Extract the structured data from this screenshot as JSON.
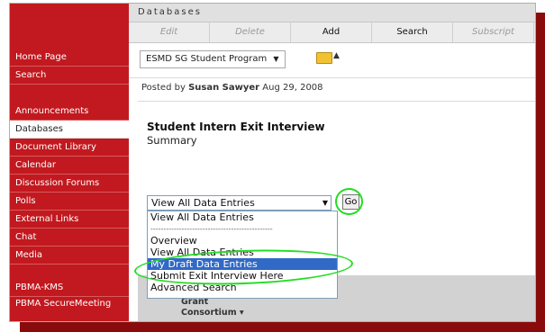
{
  "header": {
    "title": "Databases"
  },
  "toolbar": {
    "items": [
      "Edit",
      "Delete",
      "Add",
      "Search",
      "Subscript"
    ]
  },
  "program_select": {
    "value": "ESMD SG Student Program"
  },
  "sidebar": {
    "group1": [
      "Home Page",
      "Search"
    ],
    "group2": [
      "Announcements",
      "Databases",
      "Document Library",
      "Calendar",
      "Discussion Forums",
      "Polls",
      "External Links",
      "Chat",
      "Media"
    ],
    "group3": [
      "PBMA-KMS",
      "PBMA SecureMeeting"
    ]
  },
  "post": {
    "prefix": "Posted by",
    "author": "Susan Sawyer",
    "date": "Aug 29, 2008"
  },
  "entry": {
    "title": "Student Intern Exit Interview",
    "subtitle": "Summary"
  },
  "view_select": {
    "value": "View All Data Entries",
    "go_label": "Go",
    "options": [
      "View All Data Entries",
      "-----------------------------------------------",
      "Overview",
      "View All Data Entries",
      "My Draft Data Entries",
      "Submit Exit Interview Here",
      "Advanced Search"
    ],
    "selected_index": 4
  },
  "footer": {
    "line1": "Grant",
    "line2": "Consortium ▾"
  },
  "colors": {
    "sidebar": "#c1191f",
    "highlight": "#22dd22",
    "selected_option": "#3169c6"
  }
}
